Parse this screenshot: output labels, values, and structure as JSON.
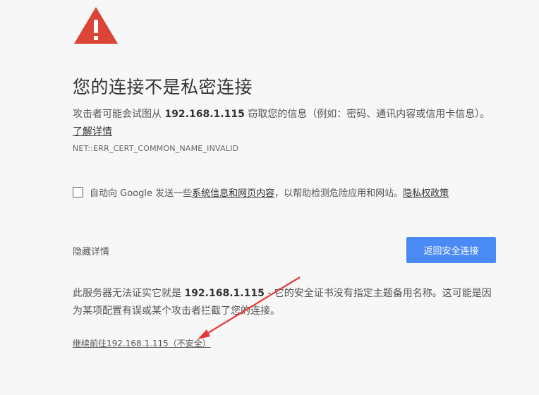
{
  "interstitial": {
    "title": "您的连接不是私密连接",
    "description_prefix": "攻击者可能会试图从 ",
    "hostname": "192.168.1.115",
    "description_suffix": " 窃取您的信息（例如：密码、通讯内容或信用卡信息）。",
    "learn_more_label": "了解详情",
    "error_code": "NET::ERR_CERT_COMMON_NAME_INVALID"
  },
  "report": {
    "checked": false,
    "text_prefix": "自动向 Google 发送一些",
    "system_info_link": "系统信息和网页内容",
    "text_middle": "，以帮助检测危险应用和网站。",
    "privacy_link": "隐私权政策"
  },
  "actions": {
    "details_label": "隐藏详情",
    "back_label": "返回安全连接",
    "accent_color": "#4a8af4"
  },
  "details": {
    "text_prefix": "此服务器无法证实它就是 ",
    "hostname": "192.168.1.115",
    "text_suffix": " - 它的安全证书没有指定主题备用名称。这可能是因为某项配置有误或某个攻击者拦截了您的连接。",
    "proceed_label": "继续前往192.168.1.115（不安全）"
  },
  "icons": {
    "warning": "warning-triangle-icon",
    "warning_color": "#db4437",
    "annotation_arrow_color": "#e53935"
  }
}
